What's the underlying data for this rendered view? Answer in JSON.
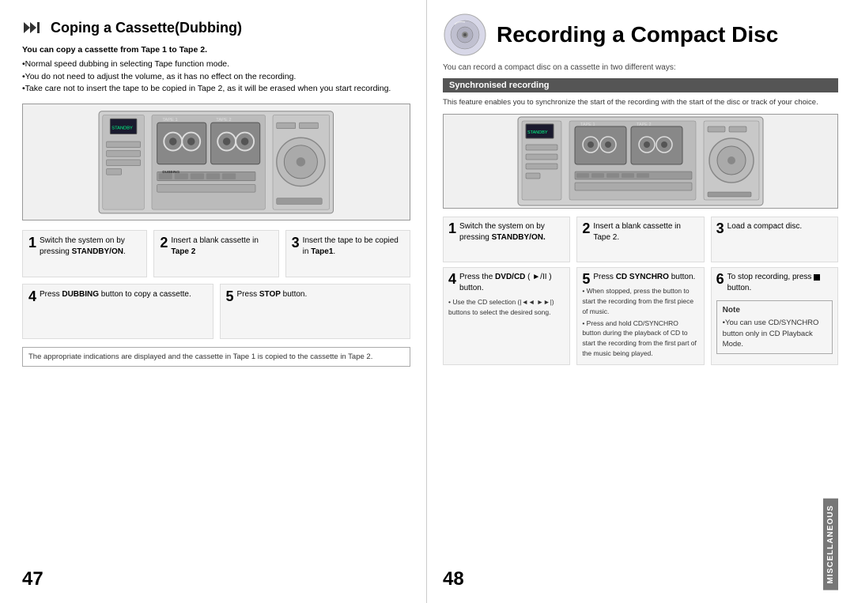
{
  "left": {
    "title": "Coping a Cassette(Dubbing)",
    "instructions": {
      "bold_line": "You can copy a cassette from Tape 1 to Tape 2.",
      "bullets": [
        "Normal speed dubbing in selecting Tape function mode.",
        "You do not need to adjust the volume, as it has no effect on the recording.",
        "Take care not to insert the tape to be copied in Tape 2, as it will be erased when you start recording."
      ]
    },
    "steps_top": [
      {
        "number": "1",
        "text": "Switch the system on by pressing",
        "bold": "STANDBY/ON."
      },
      {
        "number": "2",
        "text": "Insert a blank cassette in",
        "bold_inline": "Tape 2"
      },
      {
        "number": "3",
        "text": "Insert the tape to be copied in",
        "bold_inline": "Tape1."
      }
    ],
    "steps_bottom": [
      {
        "number": "4",
        "text_before": "Press ",
        "bold": "DUBBING",
        "text_after": " button to copy a cassette."
      },
      {
        "number": "5",
        "text_before": "Press ",
        "bold": "STOP",
        "text_after": " button."
      }
    ],
    "note": "The appropriate indications are displayed and the cassette in Tape 1 is copied to the cassette in Tape 2.",
    "page_number": "47"
  },
  "right": {
    "title": "Recording a Compact Disc",
    "subtitle": "You can record a compact disc on a cassette in two different ways:",
    "section_header": "Synchronised recording",
    "sync_description": "This feature enables you to synchronize the start of the recording with the start of the disc or track of your choice.",
    "steps_top": [
      {
        "number": "1",
        "text": "Switch the system on by pressing",
        "bold": "STANDBY/ON."
      },
      {
        "number": "2",
        "text": "Insert a blank cassette in Tape 2."
      },
      {
        "number": "3",
        "text": "Load a compact disc."
      }
    ],
    "steps_middle": [
      {
        "number": "4",
        "text": "Press the DVD/CD ( ►/II ) button.",
        "bullets": [
          "Use the CD selection (|◄◄  ►►|) buttons to select the desired song."
        ]
      },
      {
        "number": "5",
        "text_before": "Press ",
        "bold": "CD SYNCHRO",
        "text_after": " button.",
        "bullets": [
          "When stopped, press the button to start the recording from the first piece of music.",
          "Press and hold CD/SYNCHRO button during the playback of CD to start the recording from the first part of the music being played."
        ]
      },
      {
        "number": "6",
        "text": "To stop recording, press ■ button."
      }
    ],
    "note": {
      "title": "Note",
      "text": "•You can use CD/SYNCHRO button only in CD Playback Mode."
    },
    "miscellaneous_label": "MISCELLANEOUS",
    "page_number": "48"
  }
}
